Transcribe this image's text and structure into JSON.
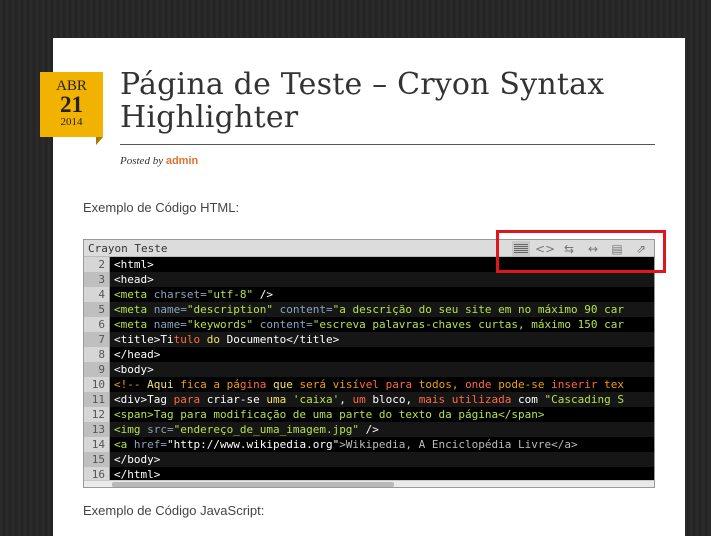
{
  "date": {
    "month": "ABR",
    "day": "21",
    "year": "2014"
  },
  "post": {
    "title": "Página de Teste – Cryon Syntax Highlighter",
    "posted_by_prefix": "Posted by",
    "author": "admin"
  },
  "labels": {
    "html_example": "Exemplo de Código HTML:",
    "js_example": "Exemplo de Código JavaScript:"
  },
  "crayon": {
    "title": "Crayon Teste",
    "toolbar_icons": [
      "toggle-line-numbers-icon",
      "toggle-plain-code-icon",
      "toggle-line-wrap-icon",
      "expand-code-icon",
      "copy-icon",
      "open-new-window-icon"
    ],
    "lines": [
      {
        "n": "2",
        "tokens": [
          [
            "t-tag",
            "<html>"
          ]
        ]
      },
      {
        "n": "3",
        "tokens": [
          [
            "t-tag",
            "<head>"
          ]
        ]
      },
      {
        "n": "4",
        "tokens": [
          [
            "t-str",
            "<meta "
          ],
          [
            "t-attr",
            "charset="
          ],
          [
            "t-str",
            "\"utf-8\""
          ],
          [
            "t-tag",
            " />"
          ]
        ]
      },
      {
        "n": "5",
        "tokens": [
          [
            "t-str",
            "<meta "
          ],
          [
            "t-attr",
            "name="
          ],
          [
            "t-str",
            "\"description\" "
          ],
          [
            "t-attr",
            "content="
          ],
          [
            "t-str",
            "\"a descrição do seu site em no máximo 90 car"
          ]
        ]
      },
      {
        "n": "6",
        "tokens": [
          [
            "t-str",
            "<meta "
          ],
          [
            "t-attr",
            "name="
          ],
          [
            "t-str",
            "\"keywords\" "
          ],
          [
            "t-attr",
            "content="
          ],
          [
            "t-str",
            "\"escreva palavras-chaves curtas, máximo 150 car"
          ]
        ]
      },
      {
        "n": "7",
        "tokens": [
          [
            "t-tag",
            "<title>Ti"
          ],
          [
            "t-kw",
            "tulo "
          ],
          [
            "t-yel",
            "do"
          ],
          [
            "t-tag",
            " Documento</title>"
          ]
        ]
      },
      {
        "n": "8",
        "tokens": [
          [
            "t-tag",
            "</head>"
          ]
        ]
      },
      {
        "n": "9",
        "tokens": [
          [
            "t-tag",
            "<body>"
          ]
        ]
      },
      {
        "n": "10",
        "tokens": [
          [
            "t-com",
            "<!-- "
          ],
          [
            "t-yel",
            "Aqui "
          ],
          [
            "t-com",
            "fica a pá"
          ],
          [
            "t-kw",
            "gina "
          ],
          [
            "t-yel",
            "que "
          ],
          [
            "t-com",
            "será visí"
          ],
          [
            "t-kw",
            "vel para "
          ],
          [
            "t-com",
            "todos, "
          ],
          [
            "t-kw",
            "onde "
          ],
          [
            "t-com",
            "pode-se "
          ],
          [
            "t-kw",
            "inserir "
          ],
          [
            "t-com",
            "tex"
          ]
        ]
      },
      {
        "n": "11",
        "tokens": [
          [
            "t-tag",
            "<div>Tag "
          ],
          [
            "t-kw",
            "para "
          ],
          [
            "t-tag",
            "criar-se "
          ],
          [
            "t-yel",
            "uma "
          ],
          [
            "t-str",
            "'caixa'"
          ],
          [
            "t-tag",
            ", "
          ],
          [
            "t-kw",
            "um "
          ],
          [
            "t-tag",
            "bloco, "
          ],
          [
            "t-kw",
            "mais utilizada "
          ],
          [
            "t-tag",
            "com "
          ],
          [
            "t-str",
            "\"Cascading S"
          ]
        ]
      },
      {
        "n": "12",
        "tokens": [
          [
            "t-str",
            "<span>Tag para modificação de uma parte do texto da página</span>"
          ]
        ]
      },
      {
        "n": "13",
        "tokens": [
          [
            "t-str",
            "<img "
          ],
          [
            "t-attr",
            "src="
          ],
          [
            "t-str",
            "\"endereço_de_uma_imagem.jpg\""
          ],
          [
            "t-tag",
            " />"
          ]
        ]
      },
      {
        "n": "14",
        "tokens": [
          [
            "t-str",
            "<a "
          ],
          [
            "t-attr",
            "href="
          ],
          [
            "t-tag",
            "\"http://www.wikipedia.org\""
          ],
          [
            "t-grey",
            ">Wikipedia, A Enciclopédia Livre</a>"
          ]
        ]
      },
      {
        "n": "15",
        "tokens": [
          [
            "t-tag",
            "</body>"
          ]
        ]
      },
      {
        "n": "16",
        "tokens": [
          [
            "t-tag",
            "</html>"
          ]
        ]
      }
    ]
  },
  "colors": {
    "accent": "#f2b200",
    "author": "#e0742a",
    "highlight": "#e0161c"
  }
}
